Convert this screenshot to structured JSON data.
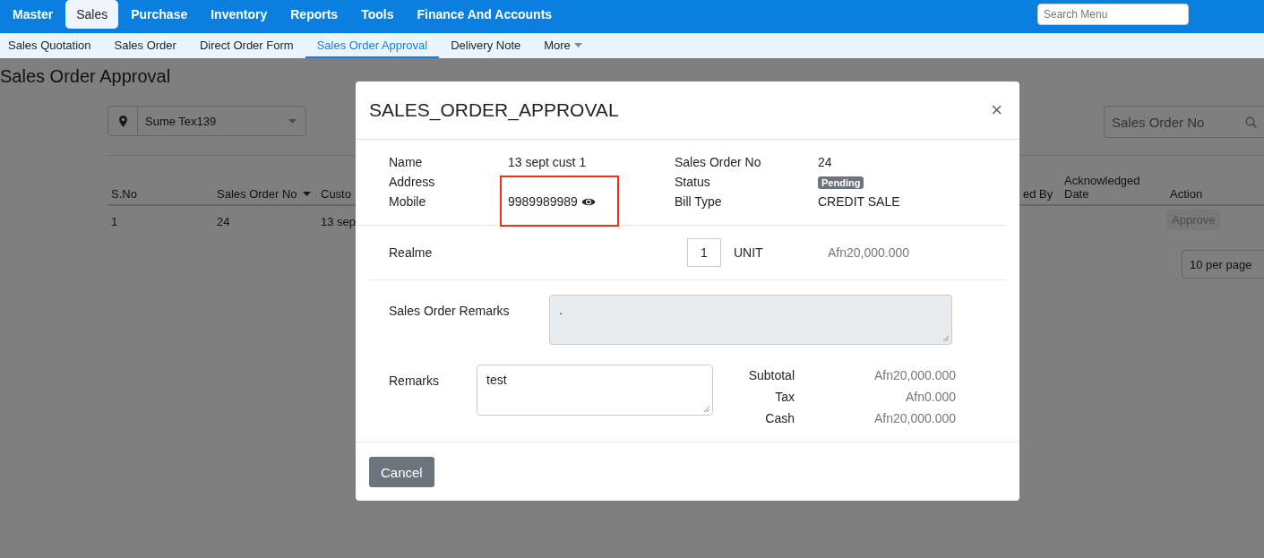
{
  "nav": {
    "items": [
      {
        "label": "Master",
        "selected": false
      },
      {
        "label": "Sales",
        "selected": true
      },
      {
        "label": "Purchase",
        "selected": false
      },
      {
        "label": "Inventory",
        "selected": false
      },
      {
        "label": "Reports",
        "selected": false
      },
      {
        "label": "Tools",
        "selected": false
      },
      {
        "label": "Finance And Accounts",
        "selected": false
      }
    ],
    "search": {
      "placeholder": "Search Menu"
    }
  },
  "subnav": {
    "items": [
      {
        "label": "Sales Quotation",
        "selected": false,
        "dropdown": false
      },
      {
        "label": "Sales Order",
        "selected": false,
        "dropdown": false
      },
      {
        "label": "Direct Order Form",
        "selected": false,
        "dropdown": false
      },
      {
        "label": "Sales Order Approval",
        "selected": true,
        "dropdown": false
      },
      {
        "label": "Delivery Note",
        "selected": false,
        "dropdown": false
      },
      {
        "label": "More",
        "selected": false,
        "dropdown": true
      }
    ]
  },
  "page": {
    "title": "Sales Order Approval",
    "branch_select": {
      "value": "Sume Tex139"
    },
    "search": {
      "placeholder": "Sales Order No"
    },
    "table": {
      "columns": [
        {
          "label": "S.No"
        },
        {
          "label": "Sales Order No",
          "sorted": true
        },
        {
          "label": "Custo"
        },
        {
          "label": "ed By"
        },
        {
          "label": "Acknowledged Date"
        },
        {
          "label": "Action"
        }
      ],
      "rows": [
        {
          "cells": [
            "1",
            "24",
            "13 sep"
          ],
          "action": "Approve"
        }
      ]
    },
    "page_size": "10 per page"
  },
  "modal": {
    "title": "SALES_ORDER_APPROVAL",
    "close_label": "×",
    "info_left": [
      {
        "label": "Name",
        "kind": "text",
        "value": "13 sept cust 1"
      },
      {
        "label": "Address",
        "kind": "text"
      },
      {
        "label": "Mobile",
        "kind": "phone",
        "value": "9989989989",
        "highlighted": true
      }
    ],
    "info_right": [
      {
        "label": "Sales Order No",
        "kind": "text",
        "value": "24"
      },
      {
        "label": "Status",
        "kind": "badge",
        "value": "Pending"
      },
      {
        "label": "Bill Type",
        "kind": "text",
        "value": "CREDIT SALE"
      }
    ],
    "items": [
      {
        "name": "Realme",
        "quantity": "1",
        "unit": "UNIT",
        "price": "Afn20,000.000"
      }
    ],
    "sales_order_remarks": {
      "label": "Sales Order Remarks",
      "value": ".",
      "disabled": true
    },
    "remarks": {
      "label": "Remarks",
      "value": "test",
      "disabled": false
    },
    "totals": [
      {
        "label": "Subtotal",
        "value": "Afn20,000.000"
      },
      {
        "label": "Tax",
        "value": "Afn0.000"
      },
      {
        "label": "Cash",
        "value": "Afn20,000.000"
      }
    ],
    "buttons": [
      "Cancel"
    ]
  }
}
